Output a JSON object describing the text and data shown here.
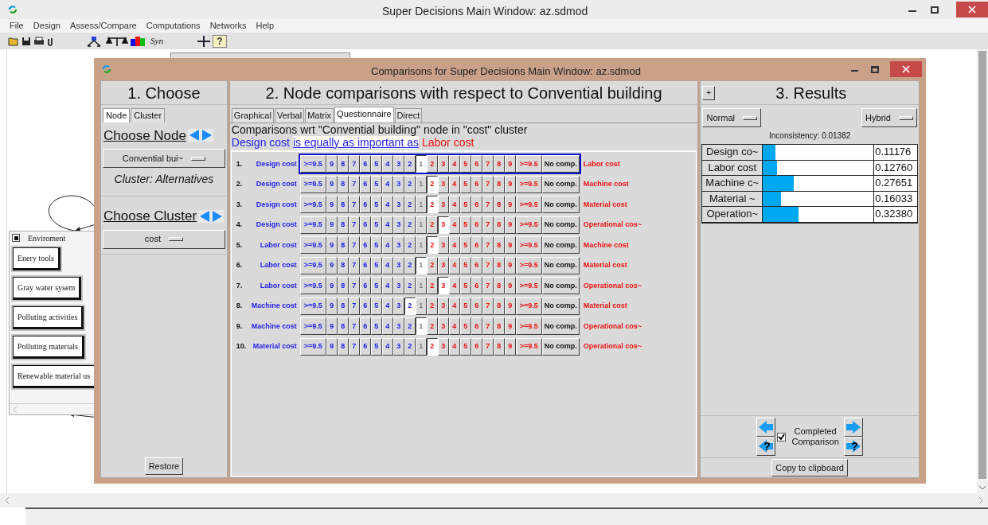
{
  "main_window": {
    "title": "Super Decisions Main Window: az.sdmod"
  },
  "menu": [
    "File",
    "Design",
    "Assess/Compare",
    "Computations",
    "Networks",
    "Help"
  ],
  "toolbar": {
    "syn_label": "Syn",
    "help_mark": "?"
  },
  "cluster_window": {
    "title": "Enviroment",
    "nodes": [
      "Enery tools",
      "Gray water sysem",
      "Polluting activities",
      "Polluting materials",
      "Renewable material us"
    ]
  },
  "dialog": {
    "title": "Comparisons for Super Decisions Main Window: az.sdmod",
    "choose": {
      "heading": "1. Choose",
      "tabs": [
        {
          "label": "Node",
          "selected": true
        },
        {
          "label": "Cluster",
          "selected": false
        }
      ],
      "node_heading": "Choose Node",
      "node_value": "Convential bui~",
      "cluster_caption": "Cluster: Alternatives",
      "cluster_heading": "Choose Cluster",
      "cluster_value": "cost",
      "restore": "Restore"
    },
    "comparisons": {
      "heading": "2. Node comparisons with respect to Convential building",
      "tabs": [
        {
          "label": "Graphical",
          "selected": false
        },
        {
          "label": "Verbal",
          "selected": false
        },
        {
          "label": "Matrix",
          "selected": false
        },
        {
          "label": "Questionnaire",
          "selected": true
        },
        {
          "label": "Direct",
          "selected": false
        }
      ],
      "wrt": "Comparisons wrt \"Convential building\" node in \"cost\" cluster",
      "statement": {
        "left": "Design cost",
        "verb": "is equally as important as",
        "right": "Labor cost"
      },
      "rows": [
        {
          "number": "1.",
          "left": "Design cost",
          "right": "Labor cost",
          "focused": true,
          "buttons": [
            {
              "label": ">=9.5",
              "selected": false
            },
            {
              "label": "9",
              "selected": false
            },
            {
              "label": "8",
              "selected": false
            },
            {
              "label": "7",
              "selected": false
            },
            {
              "label": "6",
              "selected": false
            },
            {
              "label": "5",
              "selected": false
            },
            {
              "label": "4",
              "selected": false
            },
            {
              "label": "3",
              "selected": false
            },
            {
              "label": "2",
              "selected": false
            },
            {
              "label": "1",
              "selected": true
            },
            {
              "label": "2",
              "selected": false
            },
            {
              "label": "3",
              "selected": false
            },
            {
              "label": "4",
              "selected": false
            },
            {
              "label": "5",
              "selected": false
            },
            {
              "label": "6",
              "selected": false
            },
            {
              "label": "7",
              "selected": false
            },
            {
              "label": "8",
              "selected": false
            },
            {
              "label": "9",
              "selected": false
            },
            {
              "label": ">=9.5",
              "selected": false
            },
            {
              "label": "No comp.",
              "selected": false
            }
          ]
        },
        {
          "number": "2.",
          "left": "Design cost",
          "right": "Machine cost",
          "focused": false,
          "buttons": [
            {
              "label": ">=9.5",
              "selected": false
            },
            {
              "label": "9",
              "selected": false
            },
            {
              "label": "8",
              "selected": false
            },
            {
              "label": "7",
              "selected": false
            },
            {
              "label": "6",
              "selected": false
            },
            {
              "label": "5",
              "selected": false
            },
            {
              "label": "4",
              "selected": false
            },
            {
              "label": "3",
              "selected": false
            },
            {
              "label": "2",
              "selected": false
            },
            {
              "label": "1",
              "selected": false
            },
            {
              "label": "2",
              "selected": true
            },
            {
              "label": "3",
              "selected": false
            },
            {
              "label": "4",
              "selected": false
            },
            {
              "label": "5",
              "selected": false
            },
            {
              "label": "6",
              "selected": false
            },
            {
              "label": "7",
              "selected": false
            },
            {
              "label": "8",
              "selected": false
            },
            {
              "label": "9",
              "selected": false
            },
            {
              "label": ">=9.5",
              "selected": false
            },
            {
              "label": "No comp.",
              "selected": false
            }
          ]
        },
        {
          "number": "3.",
          "left": "Design cost",
          "right": "Material cost",
          "focused": false,
          "buttons": [
            {
              "label": ">=9.5",
              "selected": false
            },
            {
              "label": "9",
              "selected": false
            },
            {
              "label": "8",
              "selected": false
            },
            {
              "label": "7",
              "selected": false
            },
            {
              "label": "6",
              "selected": false
            },
            {
              "label": "5",
              "selected": false
            },
            {
              "label": "4",
              "selected": false
            },
            {
              "label": "3",
              "selected": false
            },
            {
              "label": "2",
              "selected": false
            },
            {
              "label": "1",
              "selected": false
            },
            {
              "label": "2",
              "selected": true
            },
            {
              "label": "3",
              "selected": false
            },
            {
              "label": "4",
              "selected": false
            },
            {
              "label": "5",
              "selected": false
            },
            {
              "label": "6",
              "selected": false
            },
            {
              "label": "7",
              "selected": false
            },
            {
              "label": "8",
              "selected": false
            },
            {
              "label": "9",
              "selected": false
            },
            {
              "label": ">=9.5",
              "selected": false
            },
            {
              "label": "No comp.",
              "selected": false
            }
          ]
        },
        {
          "number": "4.",
          "left": "Design cost",
          "right": "Operational cos~",
          "focused": false,
          "buttons": [
            {
              "label": ">=9.5",
              "selected": false
            },
            {
              "label": "9",
              "selected": false
            },
            {
              "label": "8",
              "selected": false
            },
            {
              "label": "7",
              "selected": false
            },
            {
              "label": "6",
              "selected": false
            },
            {
              "label": "5",
              "selected": false
            },
            {
              "label": "4",
              "selected": false
            },
            {
              "label": "3",
              "selected": false
            },
            {
              "label": "2",
              "selected": false
            },
            {
              "label": "1",
              "selected": false
            },
            {
              "label": "2",
              "selected": false
            },
            {
              "label": "3",
              "selected": true
            },
            {
              "label": "4",
              "selected": false
            },
            {
              "label": "5",
              "selected": false
            },
            {
              "label": "6",
              "selected": false
            },
            {
              "label": "7",
              "selected": false
            },
            {
              "label": "8",
              "selected": false
            },
            {
              "label": "9",
              "selected": false
            },
            {
              "label": ">=9.5",
              "selected": false
            },
            {
              "label": "No comp.",
              "selected": false
            }
          ]
        },
        {
          "number": "5.",
          "left": "Labor cost",
          "right": "Machine cost",
          "focused": false,
          "buttons": [
            {
              "label": ">=9.5",
              "selected": false
            },
            {
              "label": "9",
              "selected": false
            },
            {
              "label": "8",
              "selected": false
            },
            {
              "label": "7",
              "selected": false
            },
            {
              "label": "6",
              "selected": false
            },
            {
              "label": "5",
              "selected": false
            },
            {
              "label": "4",
              "selected": false
            },
            {
              "label": "3",
              "selected": false
            },
            {
              "label": "2",
              "selected": false
            },
            {
              "label": "1",
              "selected": false
            },
            {
              "label": "2",
              "selected": true
            },
            {
              "label": "3",
              "selected": false
            },
            {
              "label": "4",
              "selected": false
            },
            {
              "label": "5",
              "selected": false
            },
            {
              "label": "6",
              "selected": false
            },
            {
              "label": "7",
              "selected": false
            },
            {
              "label": "8",
              "selected": false
            },
            {
              "label": "9",
              "selected": false
            },
            {
              "label": ">=9.5",
              "selected": false
            },
            {
              "label": "No comp.",
              "selected": false
            }
          ]
        },
        {
          "number": "6.",
          "left": "Labor cost",
          "right": "Material cost",
          "focused": false,
          "buttons": [
            {
              "label": ">=9.5",
              "selected": false
            },
            {
              "label": "9",
              "selected": false
            },
            {
              "label": "8",
              "selected": false
            },
            {
              "label": "7",
              "selected": false
            },
            {
              "label": "6",
              "selected": false
            },
            {
              "label": "5",
              "selected": false
            },
            {
              "label": "4",
              "selected": false
            },
            {
              "label": "3",
              "selected": false
            },
            {
              "label": "2",
              "selected": false
            },
            {
              "label": "1",
              "selected": true
            },
            {
              "label": "2",
              "selected": false
            },
            {
              "label": "3",
              "selected": false
            },
            {
              "label": "4",
              "selected": false
            },
            {
              "label": "5",
              "selected": false
            },
            {
              "label": "6",
              "selected": false
            },
            {
              "label": "7",
              "selected": false
            },
            {
              "label": "8",
              "selected": false
            },
            {
              "label": "9",
              "selected": false
            },
            {
              "label": ">=9.5",
              "selected": false
            },
            {
              "label": "No comp.",
              "selected": false
            }
          ]
        },
        {
          "number": "7.",
          "left": "Labor cost",
          "right": "Operational cos~",
          "focused": false,
          "buttons": [
            {
              "label": ">=9.5",
              "selected": false
            },
            {
              "label": "9",
              "selected": false
            },
            {
              "label": "8",
              "selected": false
            },
            {
              "label": "7",
              "selected": false
            },
            {
              "label": "6",
              "selected": false
            },
            {
              "label": "5",
              "selected": false
            },
            {
              "label": "4",
              "selected": false
            },
            {
              "label": "3",
              "selected": false
            },
            {
              "label": "2",
              "selected": false
            },
            {
              "label": "1",
              "selected": false
            },
            {
              "label": "2",
              "selected": false
            },
            {
              "label": "3",
              "selected": true
            },
            {
              "label": "4",
              "selected": false
            },
            {
              "label": "5",
              "selected": false
            },
            {
              "label": "6",
              "selected": false
            },
            {
              "label": "7",
              "selected": false
            },
            {
              "label": "8",
              "selected": false
            },
            {
              "label": "9",
              "selected": false
            },
            {
              "label": ">=9.5",
              "selected": false
            },
            {
              "label": "No comp.",
              "selected": false
            }
          ]
        },
        {
          "number": "8.",
          "left": "Machine cost",
          "right": "Material cost",
          "focused": false,
          "buttons": [
            {
              "label": ">=9.5",
              "selected": false
            },
            {
              "label": "9",
              "selected": false
            },
            {
              "label": "8",
              "selected": false
            },
            {
              "label": "7",
              "selected": false
            },
            {
              "label": "6",
              "selected": false
            },
            {
              "label": "5",
              "selected": false
            },
            {
              "label": "4",
              "selected": false
            },
            {
              "label": "3",
              "selected": false
            },
            {
              "label": "2",
              "selected": true
            },
            {
              "label": "1",
              "selected": false
            },
            {
              "label": "2",
              "selected": false
            },
            {
              "label": "3",
              "selected": false
            },
            {
              "label": "4",
              "selected": false
            },
            {
              "label": "5",
              "selected": false
            },
            {
              "label": "6",
              "selected": false
            },
            {
              "label": "7",
              "selected": false
            },
            {
              "label": "8",
              "selected": false
            },
            {
              "label": "9",
              "selected": false
            },
            {
              "label": ">=9.5",
              "selected": false
            },
            {
              "label": "No comp.",
              "selected": false
            }
          ]
        },
        {
          "number": "9.",
          "left": "Machine cost",
          "right": "Operational cos~",
          "focused": false,
          "buttons": [
            {
              "label": ">=9.5",
              "selected": false
            },
            {
              "label": "9",
              "selected": false
            },
            {
              "label": "8",
              "selected": false
            },
            {
              "label": "7",
              "selected": false
            },
            {
              "label": "6",
              "selected": false
            },
            {
              "label": "5",
              "selected": false
            },
            {
              "label": "4",
              "selected": false
            },
            {
              "label": "3",
              "selected": false
            },
            {
              "label": "2",
              "selected": false
            },
            {
              "label": "1",
              "selected": true
            },
            {
              "label": "2",
              "selected": false
            },
            {
              "label": "3",
              "selected": false
            },
            {
              "label": "4",
              "selected": false
            },
            {
              "label": "5",
              "selected": false
            },
            {
              "label": "6",
              "selected": false
            },
            {
              "label": "7",
              "selected": false
            },
            {
              "label": "8",
              "selected": false
            },
            {
              "label": "9",
              "selected": false
            },
            {
              "label": ">=9.5",
              "selected": false
            },
            {
              "label": "No comp.",
              "selected": false
            }
          ]
        },
        {
          "number": "10.",
          "left": "Material cost",
          "right": "Operational cos~",
          "focused": false,
          "buttons": [
            {
              "label": ">=9.5",
              "selected": false
            },
            {
              "label": "9",
              "selected": false
            },
            {
              "label": "8",
              "selected": false
            },
            {
              "label": "7",
              "selected": false
            },
            {
              "label": "6",
              "selected": false
            },
            {
              "label": "5",
              "selected": false
            },
            {
              "label": "4",
              "selected": false
            },
            {
              "label": "3",
              "selected": false
            },
            {
              "label": "2",
              "selected": false
            },
            {
              "label": "1",
              "selected": false
            },
            {
              "label": "2",
              "selected": true
            },
            {
              "label": "3",
              "selected": false
            },
            {
              "label": "4",
              "selected": false
            },
            {
              "label": "5",
              "selected": false
            },
            {
              "label": "6",
              "selected": false
            },
            {
              "label": "7",
              "selected": false
            },
            {
              "label": "8",
              "selected": false
            },
            {
              "label": "9",
              "selected": false
            },
            {
              "label": ">=9.5",
              "selected": false
            },
            {
              "label": "No comp.",
              "selected": false
            }
          ]
        }
      ]
    },
    "results": {
      "heading": "3. Results",
      "plus": "+",
      "mode_left": "Normal",
      "mode_right": "Hybrid",
      "inconsistency": "Inconsistency: 0.01382",
      "items": [
        {
          "name": "Design co~",
          "value": "0.11176",
          "level": 0.11176
        },
        {
          "name": "Labor cost",
          "value": "0.12760",
          "level": 0.1276
        },
        {
          "name": "Machine c~",
          "value": "0.27651",
          "level": 0.27651
        },
        {
          "name": "Material ~",
          "value": "0.16033",
          "level": 0.16033
        },
        {
          "name": "Operation~",
          "value": "0.32380",
          "level": 0.3238
        }
      ],
      "prev_incomplete_mark": "?",
      "next_incomplete_mark": "?",
      "completed": {
        "label": "Completed Comparison",
        "checked": true
      },
      "copy": "Copy to clipboard"
    }
  }
}
